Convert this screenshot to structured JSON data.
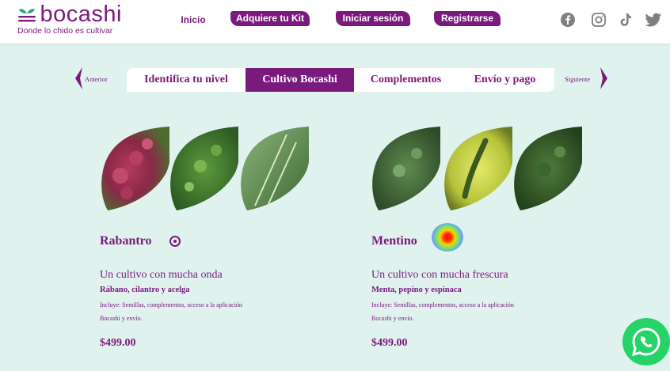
{
  "header": {
    "logo_text": "bocashi",
    "logo_tagline": "Donde lo chido es cultivar",
    "nav": {
      "inicio": "Inicio",
      "adquiere": "Adquiere tu Kit",
      "iniciar": "Iniciar sesión",
      "registrarse": "Registrarse"
    },
    "social_icons": [
      "facebook-icon",
      "instagram-icon",
      "tiktok-icon",
      "twitter-icon"
    ]
  },
  "steps": {
    "prev": "Anterior",
    "next": "Siguiente",
    "items": [
      "Identifica tu nivel",
      "Cultivo Bocashi",
      "Complementos",
      "Envío y pago"
    ],
    "active_index": 1
  },
  "products": [
    {
      "name": "Rabantro",
      "subtitle": "Un cultivo  con mucha onda",
      "plants": "Rábano, cilantro y acelga",
      "includes_1": "Incluye: Semillas, complementos, acceso a la aplicación",
      "includes_2": "Bocashi y envío.",
      "price": "$499.00"
    },
    {
      "name": "Mentino",
      "subtitle": "Un cultivo con mucha frescura",
      "plants": "Menta, pepino y espinaca",
      "includes_1": "Incluye: Semillas, complementos, acceso a la aplicación",
      "includes_2": "Bocashi y envío.",
      "price": "$499.00"
    }
  ],
  "colors": {
    "brand": "#7b1a7d",
    "background": "#dff2ee",
    "whatsapp": "#25d366"
  }
}
